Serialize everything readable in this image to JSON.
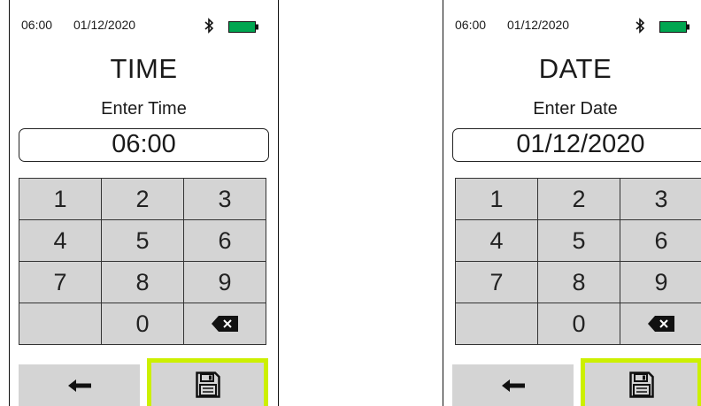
{
  "screens": [
    {
      "status": {
        "time": "06:00",
        "date": "01/12/2020",
        "bluetooth_icon": "bluetooth-icon",
        "battery_icon": "battery-icon",
        "battery_color": "#00a651"
      },
      "title": "TIME",
      "prompt": "Enter Time",
      "value": "06:00"
    },
    {
      "status": {
        "time": "06:00",
        "date": "01/12/2020",
        "bluetooth_icon": "bluetooth-icon",
        "battery_icon": "battery-icon",
        "battery_color": "#00a651"
      },
      "title": "DATE",
      "prompt": "Enter Date",
      "value": "01/12/2020"
    }
  ],
  "keypad": {
    "keys": [
      "1",
      "2",
      "3",
      "4",
      "5",
      "6",
      "7",
      "8",
      "9",
      "",
      "0"
    ],
    "backspace_icon": "backspace-icon"
  },
  "nav": {
    "back_icon": "back-arrow-icon",
    "save_icon": "save-icon",
    "save_highlight": "#ccf000"
  }
}
